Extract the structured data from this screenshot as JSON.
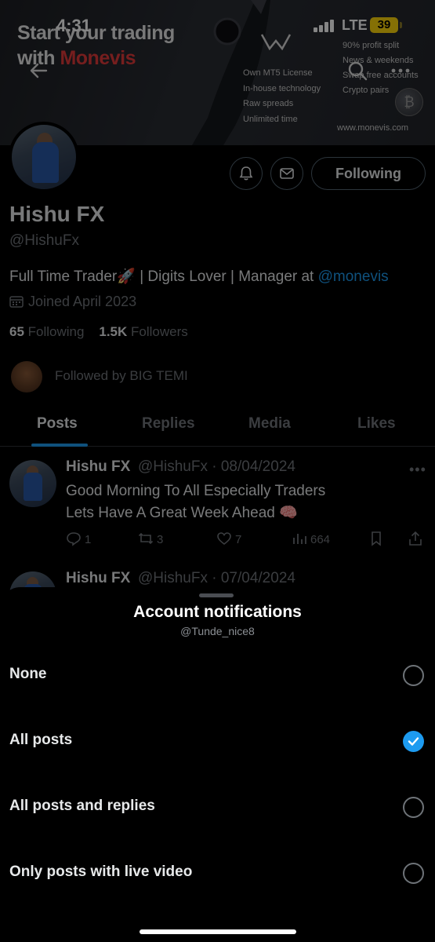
{
  "status_bar": {
    "time": "4:31",
    "network": "LTE",
    "battery": "39"
  },
  "banner_ad": {
    "headline_line1": "Start your trading",
    "headline_line2_prefix": "with",
    "headline_brand": "Monevis",
    "features_left": [
      "Own MT5 License",
      "In-house technology",
      "Raw spreads",
      "Unlimited time"
    ],
    "features_right": [
      "90% profit split",
      "News & weekends",
      "Swap free accounts",
      "Crypto pairs"
    ],
    "url": "www.monevis.com",
    "brand_color": "#e23a3a"
  },
  "profile": {
    "display_name": "Hishu FX",
    "handle": "@HishuFx",
    "bio_text": "Full Time Trader🚀 | Digits Lover | Manager at ",
    "bio_mention": "@monevis",
    "joined": "Joined April 2023",
    "following_count": "65",
    "following_label": "Following",
    "followers_count": "1.5K",
    "followers_label": "Followers",
    "followed_by": "Followed by BIG TEMI",
    "follow_button": "Following"
  },
  "tabs": [
    {
      "label": "Posts",
      "active": true
    },
    {
      "label": "Replies",
      "active": false
    },
    {
      "label": "Media",
      "active": false
    },
    {
      "label": "Likes",
      "active": false
    }
  ],
  "posts": [
    {
      "name": "Hishu FX",
      "meta": "@HishuFx · 08/04/2024",
      "line1": "Good Morning To All Especially Traders",
      "line2": "Lets Have A Great Week Ahead 🧠",
      "replies": "1",
      "reposts": "3",
      "likes": "7",
      "views": "664"
    },
    {
      "name": "Hishu FX",
      "meta": "@HishuFx · 07/04/2024"
    }
  ],
  "sheet": {
    "title": "Account notifications",
    "subtitle": "@Tunde_nice8",
    "options": [
      {
        "label": "None",
        "selected": false
      },
      {
        "label": "All posts",
        "selected": true
      },
      {
        "label": "All posts and replies",
        "selected": false
      },
      {
        "label": "Only posts with live video",
        "selected": false
      }
    ]
  },
  "colors": {
    "accent": "#1d9bf0",
    "muted_text": "#71767b",
    "background": "#000000"
  }
}
